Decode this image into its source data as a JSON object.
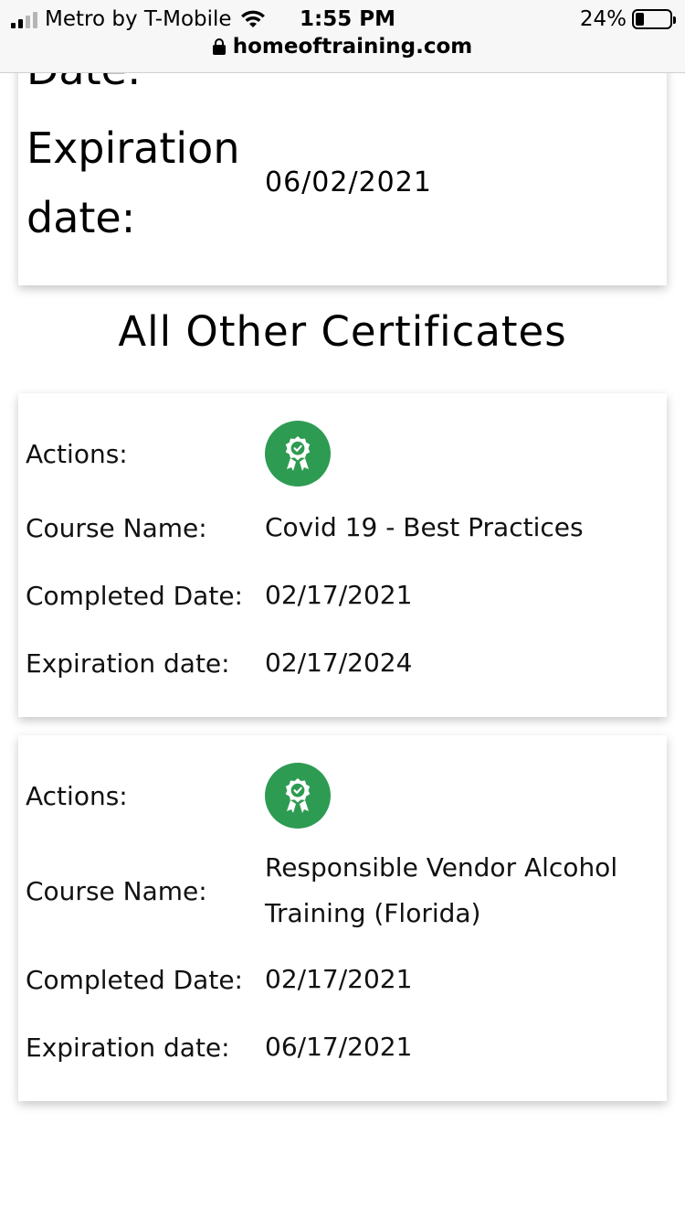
{
  "status_bar": {
    "carrier": "Metro by T-Mobile",
    "time": "1:55 PM",
    "battery_percent": "24%",
    "battery_level": 0.24,
    "url": "homeoftraining.com"
  },
  "top_card": {
    "cut_label": "Date:",
    "expiration_label": "Expiration date:",
    "expiration_value": "06/02/2021"
  },
  "section_title": "All Other Certificates",
  "certificates": [
    {
      "actions_label": "Actions:",
      "action_icon": "certificate-badge-icon",
      "course_label": "Course Name:",
      "course_name": "Covid 19 - Best Practices",
      "completed_label": "Completed Date:",
      "completed_date": "02/17/2021",
      "expiration_label": "Expiration date:",
      "expiration_date": "02/17/2024"
    },
    {
      "actions_label": "Actions:",
      "action_icon": "certificate-badge-icon",
      "course_label": "Course Name:",
      "course_name": "Responsible Vendor Alcohol Training (Florida)",
      "completed_label": "Completed Date:",
      "completed_date": "02/17/2021",
      "expiration_label": "Expiration date:",
      "expiration_date": "06/17/2021"
    }
  ],
  "colors": {
    "badge_green": "#2e9b52",
    "status_bar_bg": "#f7f7f7"
  }
}
